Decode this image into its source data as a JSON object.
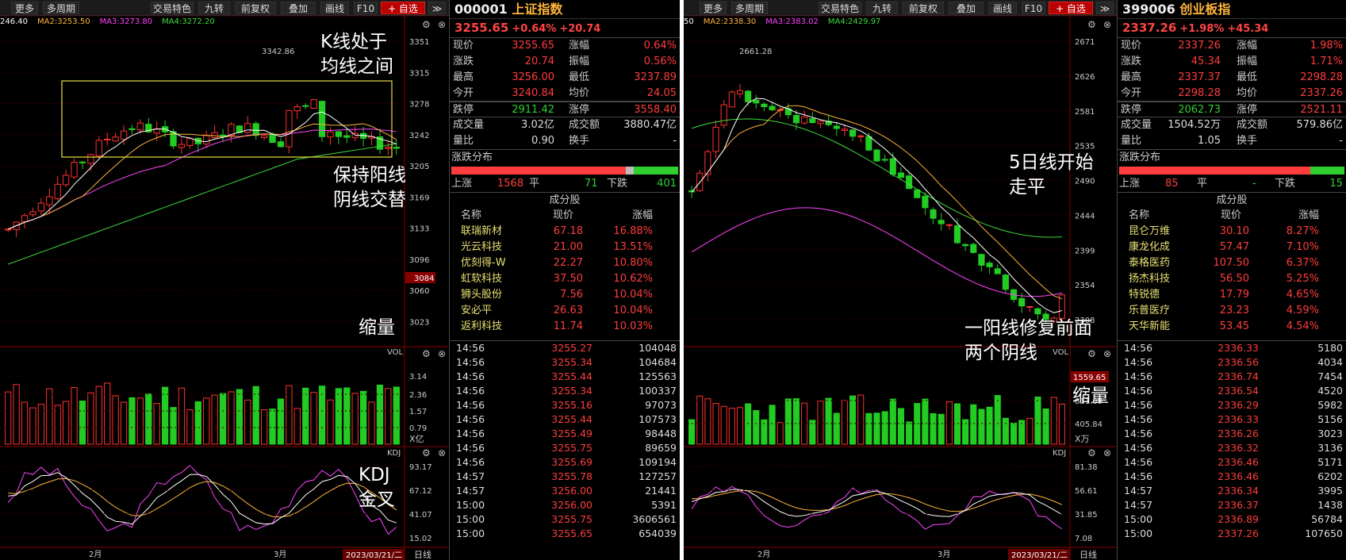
{
  "left": {
    "toolbar": [
      "更多",
      "多周期",
      "交易特色",
      "九转",
      "前复权",
      "叠加",
      "画线",
      "F10",
      "+ 自选"
    ],
    "ma_labels": [
      {
        "text": "246.40",
        "color": "#ffffff"
      },
      {
        "text": "MA2:3253.50",
        "color": "#ffb43a"
      },
      {
        "text": "MA3:3273.80",
        "color": "#ff44ff"
      },
      {
        "text": "MA4:3272.20",
        "color": "#3ddc3d"
      }
    ],
    "price_axis": [
      "3351",
      "3315",
      "3278",
      "3242",
      "3205",
      "3169",
      "3133",
      "3096",
      "3060",
      "3023"
    ],
    "price_marker": "3084",
    "high_label": "3342.86",
    "vol_title": "VOL",
    "vol_axis": [
      "3.14",
      "2.36",
      "1.57",
      "0.79"
    ],
    "vol_unit": "X亿",
    "kdj_title": "KDJ",
    "kdj_axis": [
      "93.17",
      "67.12",
      "41.07",
      "15.02"
    ],
    "months": [
      "2月",
      "3月"
    ],
    "date": "2023/03/21/二",
    "period": "日线",
    "notes": {
      "n1": "K线处于\n均线之间",
      "n2": "保持阳线\n阴线交替",
      "n3": "缩量",
      "n4": "KDJ\n金叉"
    }
  },
  "left_quote": {
    "code": "000001",
    "name": "上证指数",
    "price": "3255.65",
    "change": "+0.64%",
    "change_abs": "+20.74",
    "rows": [
      [
        "现价",
        "3255.65",
        "涨幅",
        "0.64%"
      ],
      [
        "涨跌",
        "20.74",
        "振幅",
        "0.56%"
      ],
      [
        "最高",
        "3256.00",
        "最低",
        "3237.89"
      ],
      [
        "今开",
        "3240.84",
        "均价",
        "24.05"
      ]
    ],
    "limit": [
      "跌停",
      "2911.42",
      "涨停",
      "3558.40"
    ],
    "vol_rows": [
      [
        "成交量",
        "3.02亿",
        "成交额",
        "3880.47亿"
      ],
      [
        "量比",
        "0.90",
        "换手",
        "-"
      ]
    ],
    "dist_title": "涨跌分布",
    "dist": {
      "up_label": "上涨",
      "up": "1568",
      "flat_label": "平",
      "flat": "71",
      "down_label": "下跌",
      "down": "401"
    },
    "comp_title": "成分股",
    "comp_headers": [
      "名称",
      "现价",
      "涨幅"
    ],
    "components": [
      [
        "联瑞新材",
        "67.18",
        "16.88%"
      ],
      [
        "光云科技",
        "21.00",
        "13.51%"
      ],
      [
        "优刻得-W",
        "22.27",
        "10.80%"
      ],
      [
        "虹软科技",
        "37.50",
        "10.62%"
      ],
      [
        "狮头股份",
        "7.56",
        "10.04%"
      ],
      [
        "安必平",
        "26.63",
        "10.04%"
      ],
      [
        "返利科技",
        "11.74",
        "10.03%"
      ]
    ],
    "ticks": [
      [
        "14:56",
        "3255.27",
        "104048"
      ],
      [
        "14:56",
        "3255.34",
        "104684"
      ],
      [
        "14:56",
        "3255.44",
        "125563"
      ],
      [
        "14:56",
        "3255.34",
        "100337"
      ],
      [
        "14:56",
        "3255.16",
        "97073"
      ],
      [
        "14:56",
        "3255.44",
        "107573"
      ],
      [
        "14:56",
        "3255.49",
        "98448"
      ],
      [
        "14:56",
        "3255.75",
        "89659"
      ],
      [
        "14:56",
        "3255.69",
        "109194"
      ],
      [
        "14:57",
        "3255.78",
        "127257"
      ],
      [
        "14:57",
        "3256.00",
        "21441"
      ],
      [
        "15:00",
        "3256.00",
        "5391"
      ],
      [
        "15:00",
        "3255.75",
        "3606561"
      ],
      [
        "15:00",
        "3255.65",
        "654039"
      ]
    ]
  },
  "right": {
    "toolbar": [
      "更多",
      "多周期",
      "交易特色",
      "九转",
      "前复权",
      "叠加",
      "画线",
      "F10",
      "+ 自选"
    ],
    "ma_labels": [
      {
        "text": "50",
        "color": "#ffffff"
      },
      {
        "text": "MA2:2338.30",
        "color": "#ffb43a"
      },
      {
        "text": "MA3:2383.02",
        "color": "#ff44ff"
      },
      {
        "text": "MA4:2429.97",
        "color": "#3ddc3d"
      }
    ],
    "price_axis": [
      "2671",
      "2626",
      "2581",
      "2535",
      "2490",
      "2444",
      "2399",
      "2354",
      "2308"
    ],
    "high_label": "2661.28",
    "vol_title": "VOL",
    "vol_marker": "1559.65",
    "vol_axis": [
      "811.69",
      "405.84"
    ],
    "vol_unit": "X万",
    "kdj_title": "KDJ",
    "kdj_axis": [
      "81.38",
      "56.61",
      "31.85",
      "7.08"
    ],
    "months": [
      "2月",
      "3月"
    ],
    "date": "2023/03/21/二",
    "period": "日线",
    "notes": {
      "n1": "5日线开始\n走平",
      "n2": "一阳线修复前面\n两个阴线",
      "n3": "缩量"
    }
  },
  "right_quote": {
    "code": "399006",
    "name": "创业板指",
    "price": "2337.26",
    "change": "+1.98%",
    "change_abs": "+45.34",
    "rows": [
      [
        "现价",
        "2337.26",
        "涨幅",
        "1.98%"
      ],
      [
        "涨跌",
        "45.34",
        "振幅",
        "1.71%"
      ],
      [
        "最高",
        "2337.37",
        "最低",
        "2298.28"
      ],
      [
        "今开",
        "2298.28",
        "均价",
        "2337.26"
      ]
    ],
    "limit": [
      "跌停",
      "2062.73",
      "涨停",
      "2521.11"
    ],
    "vol_rows": [
      [
        "成交量",
        "1504.52万",
        "成交额",
        "579.86亿"
      ],
      [
        "量比",
        "1.05",
        "换手",
        "-"
      ]
    ],
    "dist_title": "涨跌分布",
    "dist": {
      "up_label": "上涨",
      "up": "85",
      "flat_label": "平",
      "flat": "-",
      "down_label": "下跌",
      "down": "15"
    },
    "comp_title": "成分股",
    "comp_headers": [
      "名称",
      "现价",
      "涨幅"
    ],
    "components": [
      [
        "昆仑万维",
        "30.10",
        "8.27%"
      ],
      [
        "康龙化成",
        "57.47",
        "7.10%"
      ],
      [
        "泰格医药",
        "107.50",
        "6.37%"
      ],
      [
        "扬杰科技",
        "56.50",
        "5.25%"
      ],
      [
        "特锐德",
        "17.79",
        "4.65%"
      ],
      [
        "乐普医疗",
        "23.23",
        "4.59%"
      ],
      [
        "天华新能",
        "53.45",
        "4.54%"
      ]
    ],
    "ticks": [
      [
        "14:56",
        "2336.33",
        "5180"
      ],
      [
        "14:56",
        "2336.56",
        "4034"
      ],
      [
        "14:56",
        "2336.74",
        "7454"
      ],
      [
        "14:56",
        "2336.54",
        "4520"
      ],
      [
        "14:56",
        "2336.29",
        "5982"
      ],
      [
        "14:56",
        "2336.33",
        "5156"
      ],
      [
        "14:56",
        "2336.26",
        "3023"
      ],
      [
        "14:56",
        "2336.32",
        "3136"
      ],
      [
        "14:56",
        "2336.46",
        "5171"
      ],
      [
        "14:56",
        "2336.46",
        "6202"
      ],
      [
        "14:57",
        "2336.34",
        "3995"
      ],
      [
        "14:57",
        "2336.37",
        "1438"
      ],
      [
        "15:00",
        "2336.89",
        "56784"
      ],
      [
        "15:00",
        "2337.26",
        "107650"
      ]
    ]
  }
}
